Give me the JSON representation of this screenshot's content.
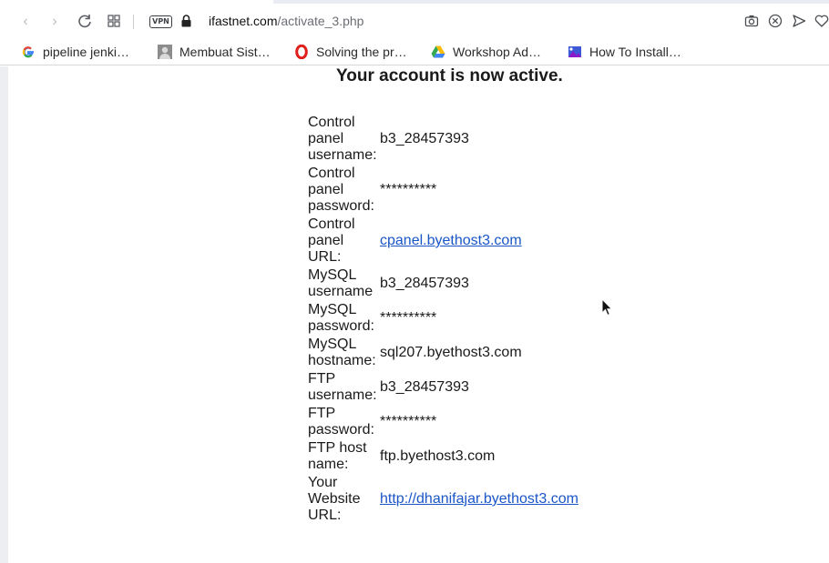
{
  "browser": {
    "address_host": "ifastnet.com",
    "address_path": "/activate_3.php",
    "vpn_badge": "VPN"
  },
  "bookmarks": [
    {
      "label": "pipeline jenki…",
      "icon": "google-icon"
    },
    {
      "label": "Membuat Sist…",
      "icon": "avatar-icon"
    },
    {
      "label": "Solving the pr…",
      "icon": "opera-icon"
    },
    {
      "label": "Workshop Ad…",
      "icon": "google-drive-icon"
    },
    {
      "label": "How To Install…",
      "icon": "bookmark-site-icon"
    }
  ],
  "page": {
    "heading": "Your account is now active.",
    "rows": [
      {
        "label": "Control panel username:",
        "value": "b3_28457393",
        "link": false
      },
      {
        "label": "Control panel password:",
        "value": "**********",
        "link": false
      },
      {
        "label": "Control panel URL:",
        "value": "cpanel.byethost3.com",
        "link": true
      },
      {
        "label": "MySQL username",
        "value": "b3_28457393",
        "link": false
      },
      {
        "label": "MySQL password:",
        "value": "**********",
        "link": false
      },
      {
        "label": "MySQL hostname:",
        "value": "sql207.byethost3.com",
        "link": false
      },
      {
        "label": "FTP username:",
        "value": "b3_28457393",
        "link": false
      },
      {
        "label": "FTP password:",
        "value": "**********",
        "link": false
      },
      {
        "label": "FTP host name:",
        "value": "ftp.byethost3.com",
        "link": false
      },
      {
        "label": "Your Website URL:",
        "value": "http://dhanifajar.byethost3.com",
        "link": true
      }
    ]
  },
  "colors": {
    "link": "#1a56c8",
    "text": "#1a1a1a",
    "accent": "#2c65d8"
  }
}
